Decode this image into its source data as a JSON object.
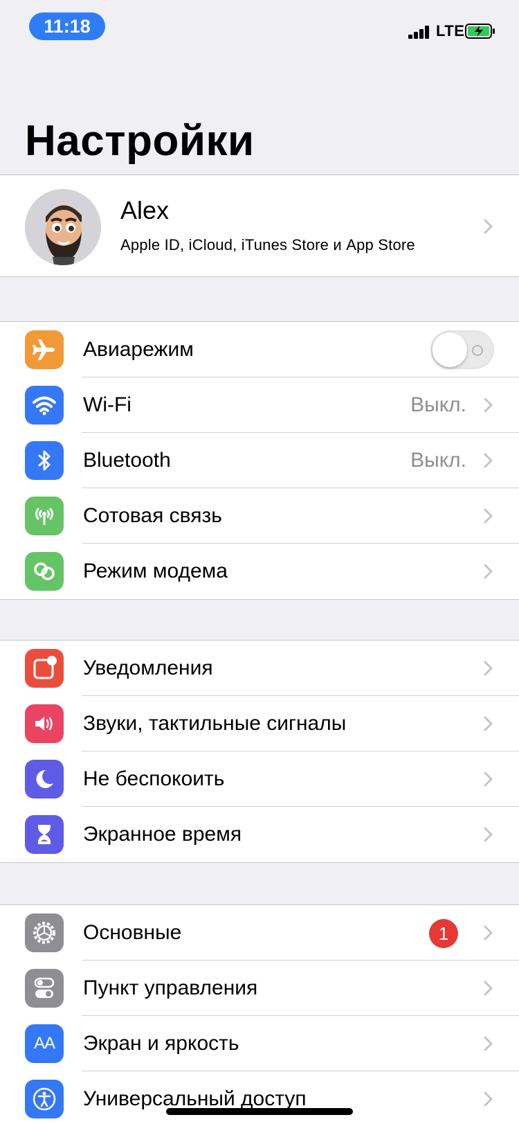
{
  "status_bar": {
    "time": "11:18",
    "network": "LTE"
  },
  "page": {
    "title": "Настройки"
  },
  "profile": {
    "name": "Alex",
    "subtitle": "Apple ID, iCloud, iTunes Store и App Store"
  },
  "groups": [
    {
      "rows": [
        {
          "label": "Авиарежим",
          "icon": "airplane-icon",
          "icon_color": "#f19a37",
          "control": "toggle",
          "toggle_on": false
        },
        {
          "label": "Wi-Fi",
          "icon": "wifi-icon",
          "icon_color": "#3478f6",
          "value": "Выкл."
        },
        {
          "label": "Bluetooth",
          "icon": "bluetooth-icon",
          "icon_color": "#3478f6",
          "value": "Выкл."
        },
        {
          "label": "Сотовая связь",
          "icon": "cellular-antenna-icon",
          "icon_color": "#65c466"
        },
        {
          "label": "Режим модема",
          "icon": "personal-hotspot-icon",
          "icon_color": "#65c466"
        }
      ]
    },
    {
      "rows": [
        {
          "label": "Уведомления",
          "icon": "notifications-icon",
          "icon_color": "#eb4d3d"
        },
        {
          "label": "Звуки, тактильные сигналы",
          "icon": "speaker-icon",
          "icon_color": "#eb4463"
        },
        {
          "label": "Не беспокоить",
          "icon": "moon-icon",
          "icon_color": "#5e5ce6"
        },
        {
          "label": "Экранное время",
          "icon": "hourglass-icon",
          "icon_color": "#5e5ce6"
        }
      ]
    },
    {
      "rows": [
        {
          "label": "Основные",
          "icon": "gear-icon",
          "icon_color": "#8e8e93",
          "badge": "1"
        },
        {
          "label": "Пункт управления",
          "icon": "control-center-icon",
          "icon_color": "#8e8e93"
        },
        {
          "label": "Экран и яркость",
          "icon": "display-brightness-icon",
          "icon_color": "#3478f6",
          "icon_text": "AA"
        },
        {
          "label": "Универсальный доступ",
          "icon": "accessibility-icon",
          "icon_color": "#3478f6"
        }
      ]
    }
  ]
}
